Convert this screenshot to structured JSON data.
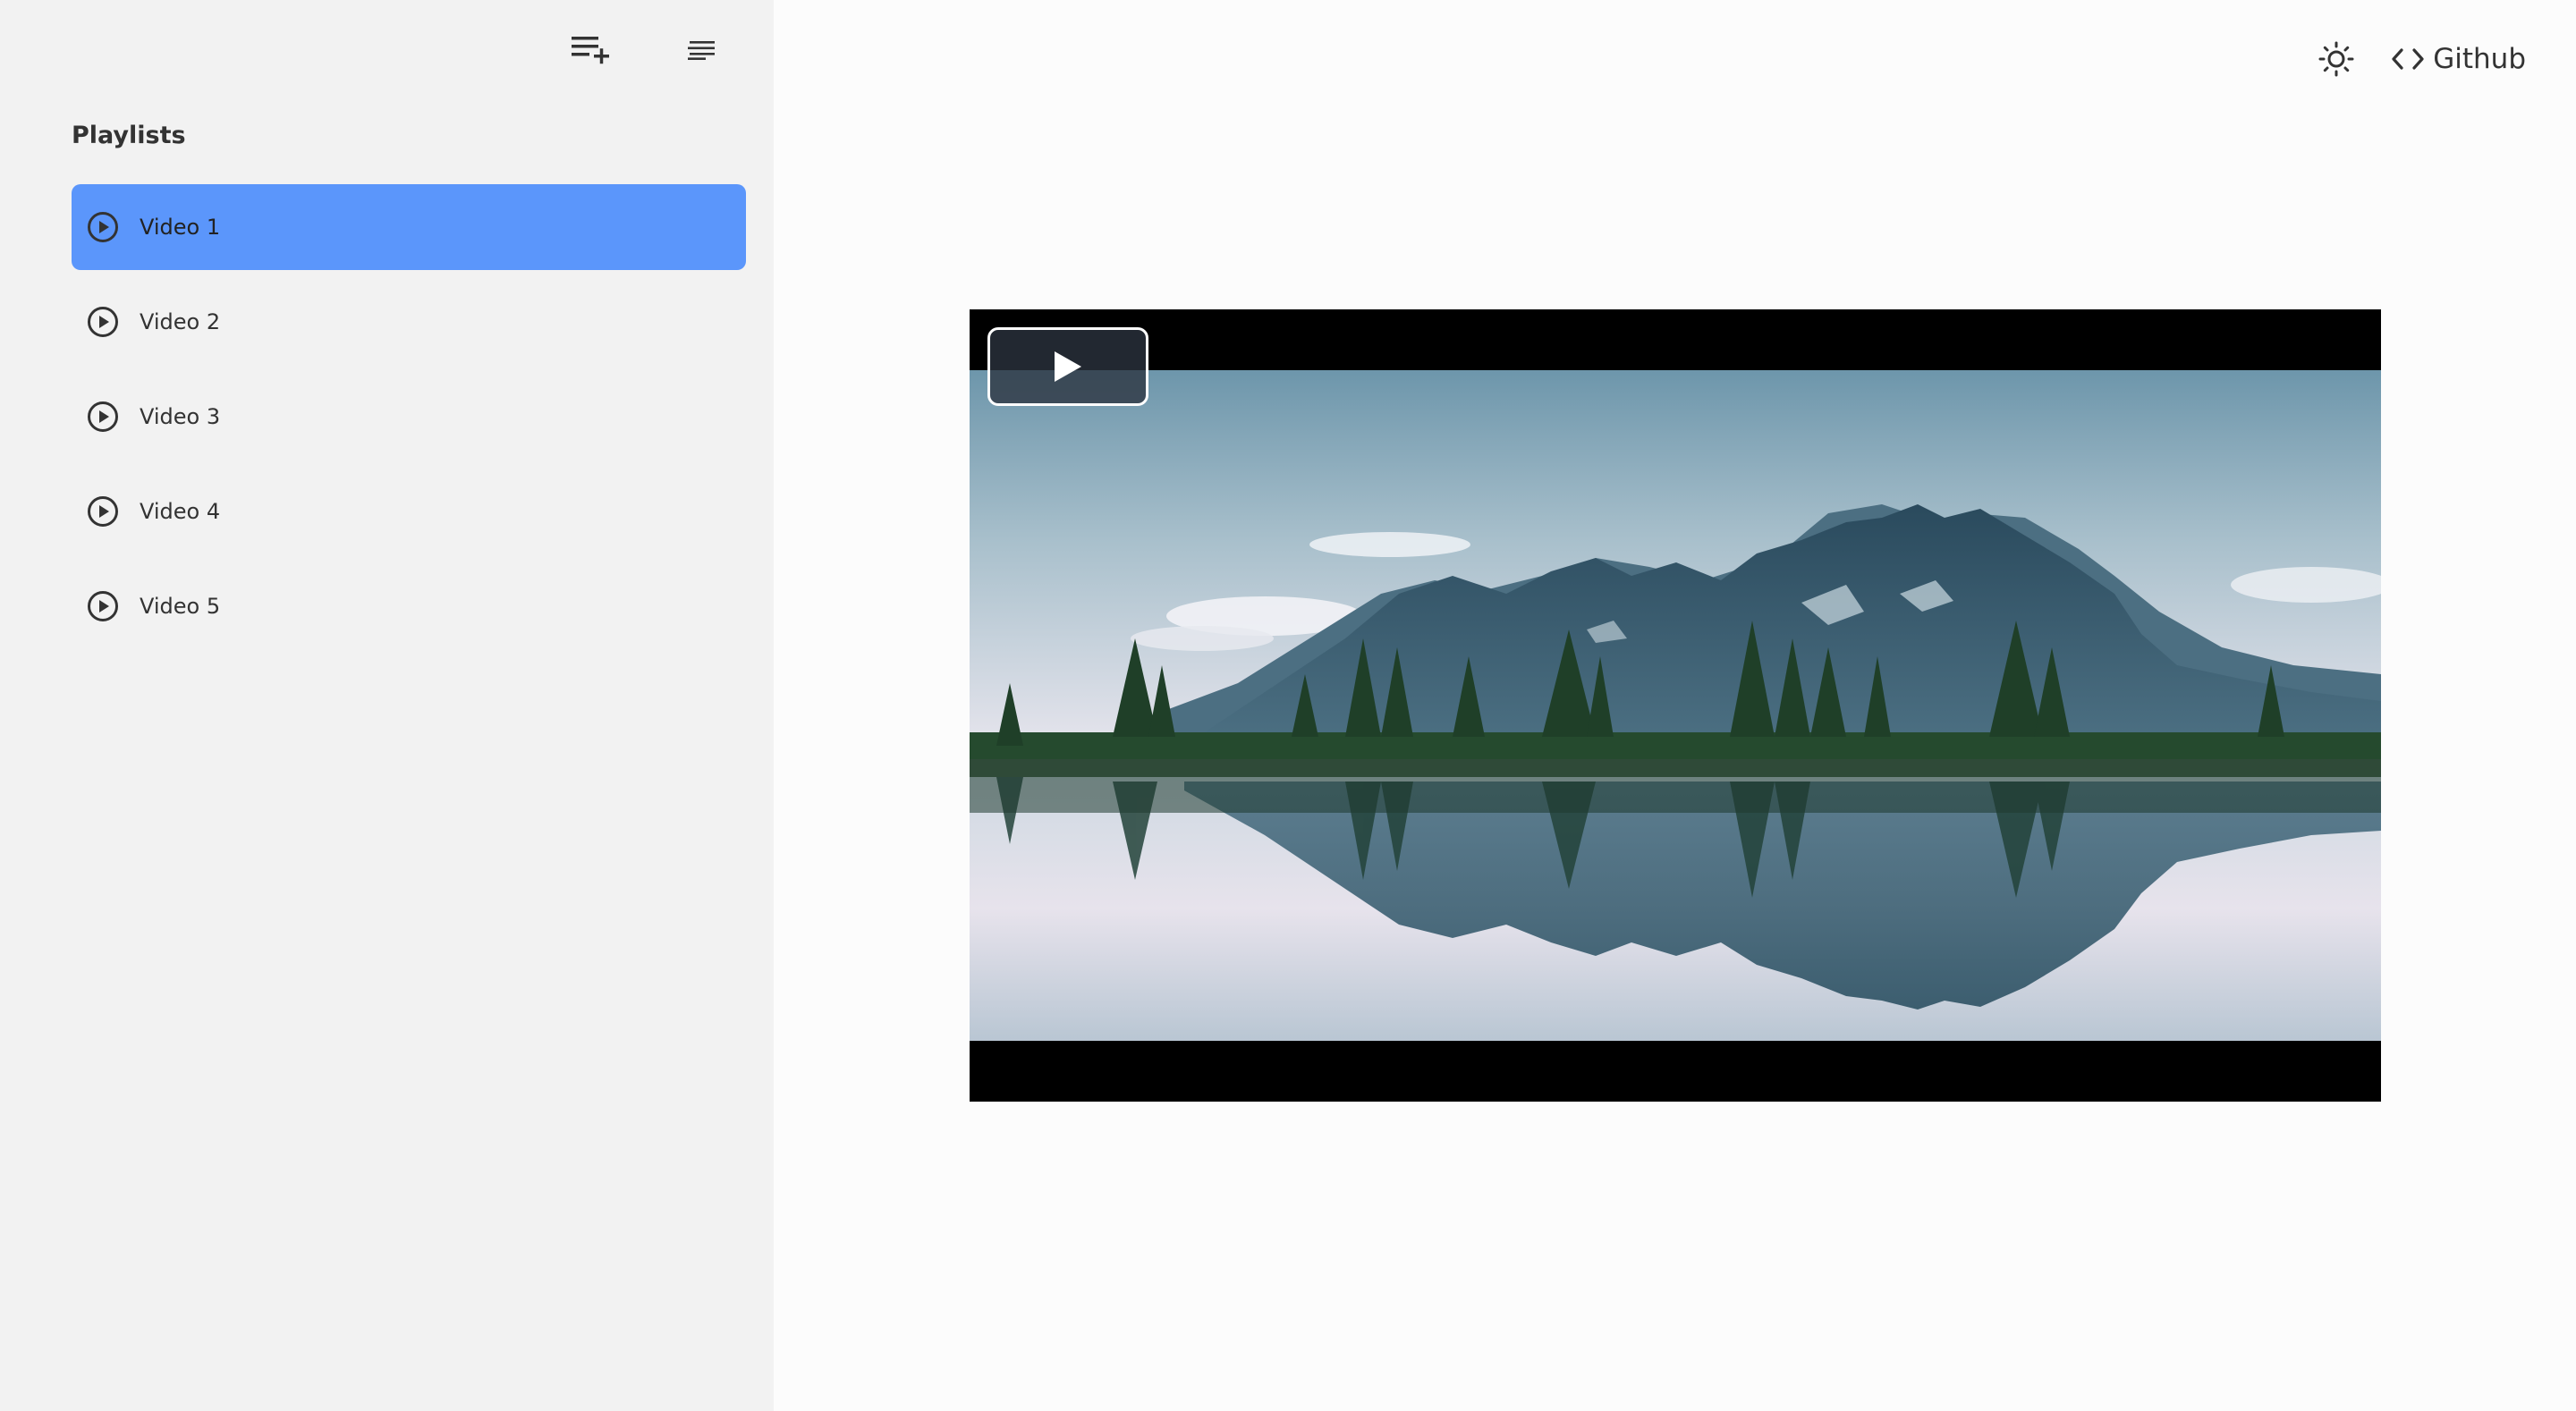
{
  "sidebar": {
    "title": "Playlists",
    "tools": {
      "add_icon": "playlist-add-icon",
      "sort_icon": "sort-icon"
    },
    "items": [
      {
        "label": "Video 1",
        "active": true
      },
      {
        "label": "Video 2",
        "active": false
      },
      {
        "label": "Video 3",
        "active": false
      },
      {
        "label": "Video 4",
        "active": false
      },
      {
        "label": "Video 5",
        "active": false
      }
    ]
  },
  "header": {
    "theme_icon": "sun-icon",
    "github_label": "Github"
  },
  "player": {
    "play_icon": "play-icon"
  },
  "colors": {
    "sidebar_bg": "#f2f2f2",
    "main_bg": "#fcfcfc",
    "accent": "#5b96fb",
    "player_bg": "#000000"
  }
}
